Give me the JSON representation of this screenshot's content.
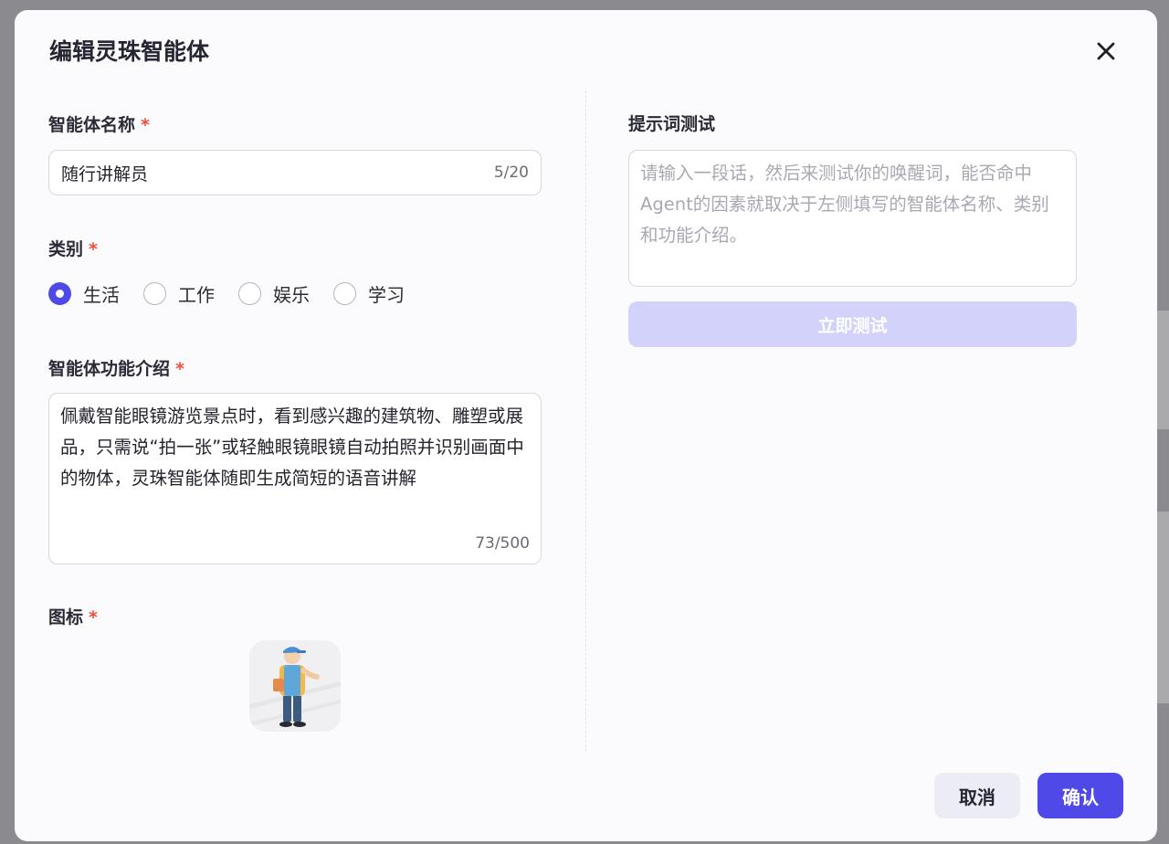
{
  "modal": {
    "title": "编辑灵珠智能体",
    "close_icon": "close-icon"
  },
  "name_field": {
    "label": "智能体名称",
    "required_mark": "*",
    "value": "随行讲解员",
    "counter": "5/20"
  },
  "category": {
    "label": "类别",
    "required_mark": "*",
    "options": [
      "生活",
      "工作",
      "娱乐",
      "学习"
    ],
    "selected": "生活"
  },
  "description": {
    "label": "智能体功能介绍",
    "required_mark": "*",
    "value": "佩戴智能眼镜游览景点时，看到感兴趣的建筑物、雕塑或展品，只需说“拍一张”或轻触眼镜眼镜自动拍照并识别画面中的物体，灵珠智能体随即生成简短的语音讲解",
    "counter": "73/500"
  },
  "icon_field": {
    "label": "图标",
    "required_mark": "*",
    "icon": "tour-guide-avatar-icon"
  },
  "prompt_test": {
    "label": "提示词测试",
    "placeholder": "请输入一段话，然后来测试你的唤醒词，能否命中Agent的因素就取决于左侧填写的智能体名称、类别和功能介绍。",
    "button_label": "立即测试"
  },
  "footer": {
    "cancel_label": "取消",
    "confirm_label": "确认"
  },
  "colors": {
    "accent": "#4f49e8",
    "accent_disabled": "#d2d2fb",
    "required": "#f24d3c"
  }
}
